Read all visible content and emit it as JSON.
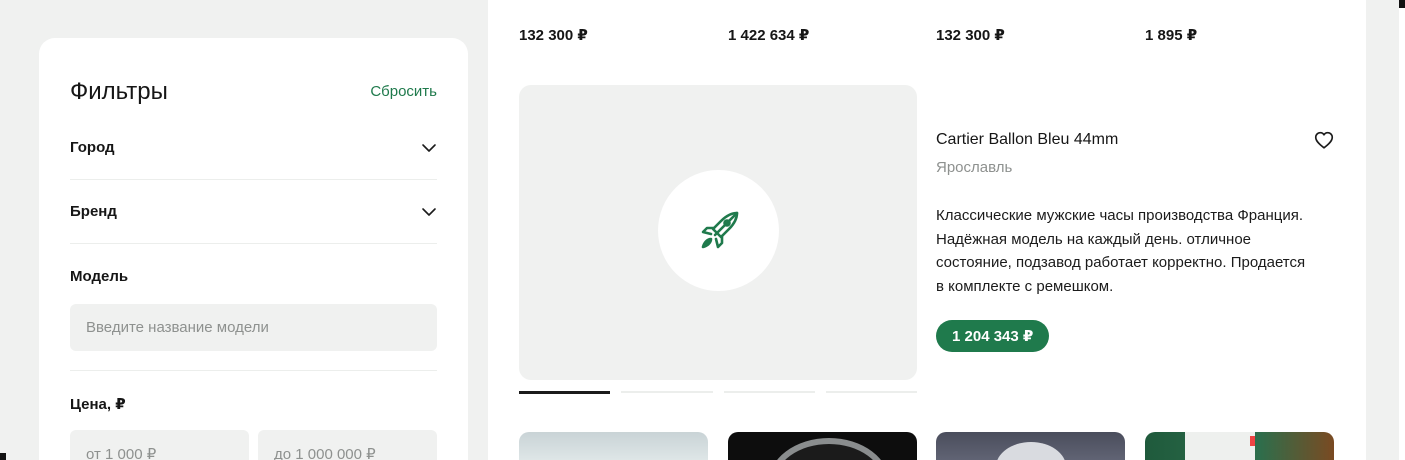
{
  "filters": {
    "title": "Фильтры",
    "reset_label": "Сбросить",
    "city_label": "Город",
    "brand_label": "Бренд",
    "model_label": "Модель",
    "model_placeholder": "Введите название модели",
    "price_label": "Цена, ₽",
    "price_from_placeholder": "от 1 000 ₽",
    "price_to_placeholder": "до 1 000 000 ₽"
  },
  "top_prices": [
    "132 300 ₽",
    "1 422 634 ₽",
    "132 300 ₽",
    "1 895 ₽"
  ],
  "card": {
    "title": "Cartier Ballon Bleu 44mm",
    "city": "Ярославль",
    "description": "Классические мужские часы производства Франция. Надёжная модель на каждый день. отличное состояние, подзавод работает корректно. Продается в комплекте с ремешком.",
    "price": "1 204 343 ₽",
    "image_icon": "rocket-icon",
    "favorite_icon": "heart-icon",
    "carousel_slides": 4,
    "active_slide": 1
  },
  "colors": {
    "accent": "#1f7a4c",
    "background": "#f0f1f0",
    "muted_text": "#8e918f"
  }
}
